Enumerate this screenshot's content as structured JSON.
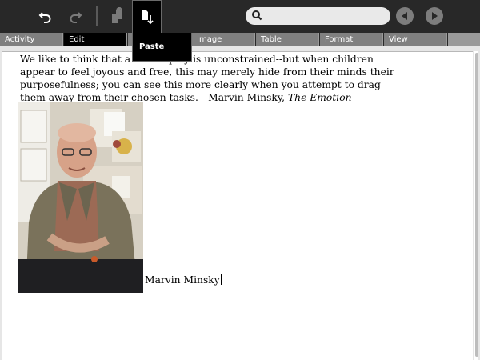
{
  "toolbar": {
    "undo_icon": "undo-icon",
    "redo_icon": "redo-icon",
    "copy_icon": "copy-icon",
    "paste_icon": "paste-icon",
    "search_placeholder": "",
    "search_value": "",
    "prev_icon": "arrow-left-icon",
    "next_icon": "arrow-right-icon"
  },
  "tabs": [
    {
      "label": "Activity"
    },
    {
      "label": "Edit"
    },
    {
      "label": ""
    },
    {
      "label": "Image"
    },
    {
      "label": "Table"
    },
    {
      "label": "Format"
    },
    {
      "label": "View"
    }
  ],
  "popup": {
    "label": "Paste"
  },
  "document": {
    "quote_text": "We like to think that a child's play is unconstrained--but when children appear to feel joyous and free, this may merely hide from their minds their purposefulness; you can see this more clearly when you attempt to drag them away from their chosen tasks. --Marvin Minsky, ",
    "quote_book": "The Emotion Machine",
    "caption": "Marvin Minsky"
  },
  "colors": {
    "toolbar_bg": "#282828",
    "tab_bg": "#808080",
    "tab_active_bg": "#000000",
    "page_bg": "#ffffff"
  }
}
